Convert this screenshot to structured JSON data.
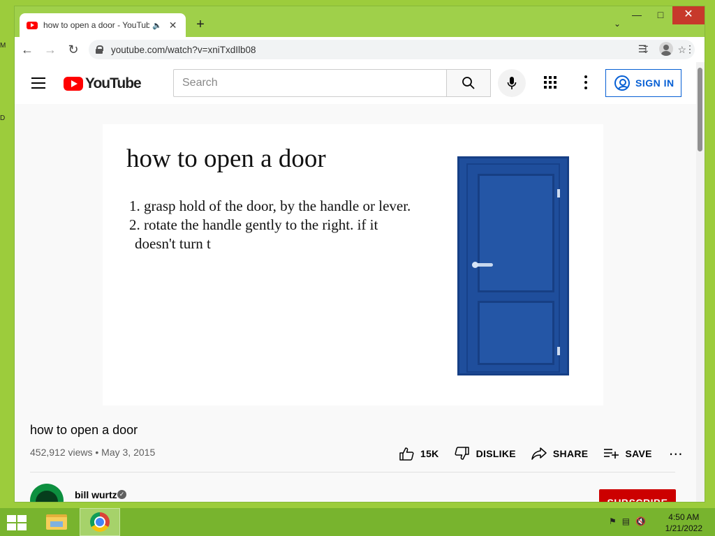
{
  "browser": {
    "tab_title": "how to open a door - YouTube",
    "url": "youtube.com/watch?v=xniTxdIlb08"
  },
  "youtube": {
    "logo_text": "YouTube",
    "search_placeholder": "Search",
    "sign_in_label": "SIGN IN"
  },
  "video": {
    "slide_title": "how to open a door",
    "steps": [
      "1. grasp hold of the door,  by the handle or lever.",
      "2. rotate the handle gently to the right. if it",
      "doesn't turn t"
    ],
    "title": "how to open a door",
    "meta": "452,912 views • May 3, 2015",
    "actions": {
      "like_count": "15K",
      "dislike_label": "DISLIKE",
      "share_label": "SHARE",
      "save_label": "SAVE"
    },
    "channel": {
      "name": "bill wurtz",
      "subscribe_label": "SUBSCRIBE"
    }
  },
  "taskbar": {
    "time": "4:50 AM",
    "date": "1/21/2022"
  },
  "icons": {
    "door_color": "#1f4e9c",
    "subscribe_color": "#cc0000",
    "link_blue": "#065fd4"
  }
}
